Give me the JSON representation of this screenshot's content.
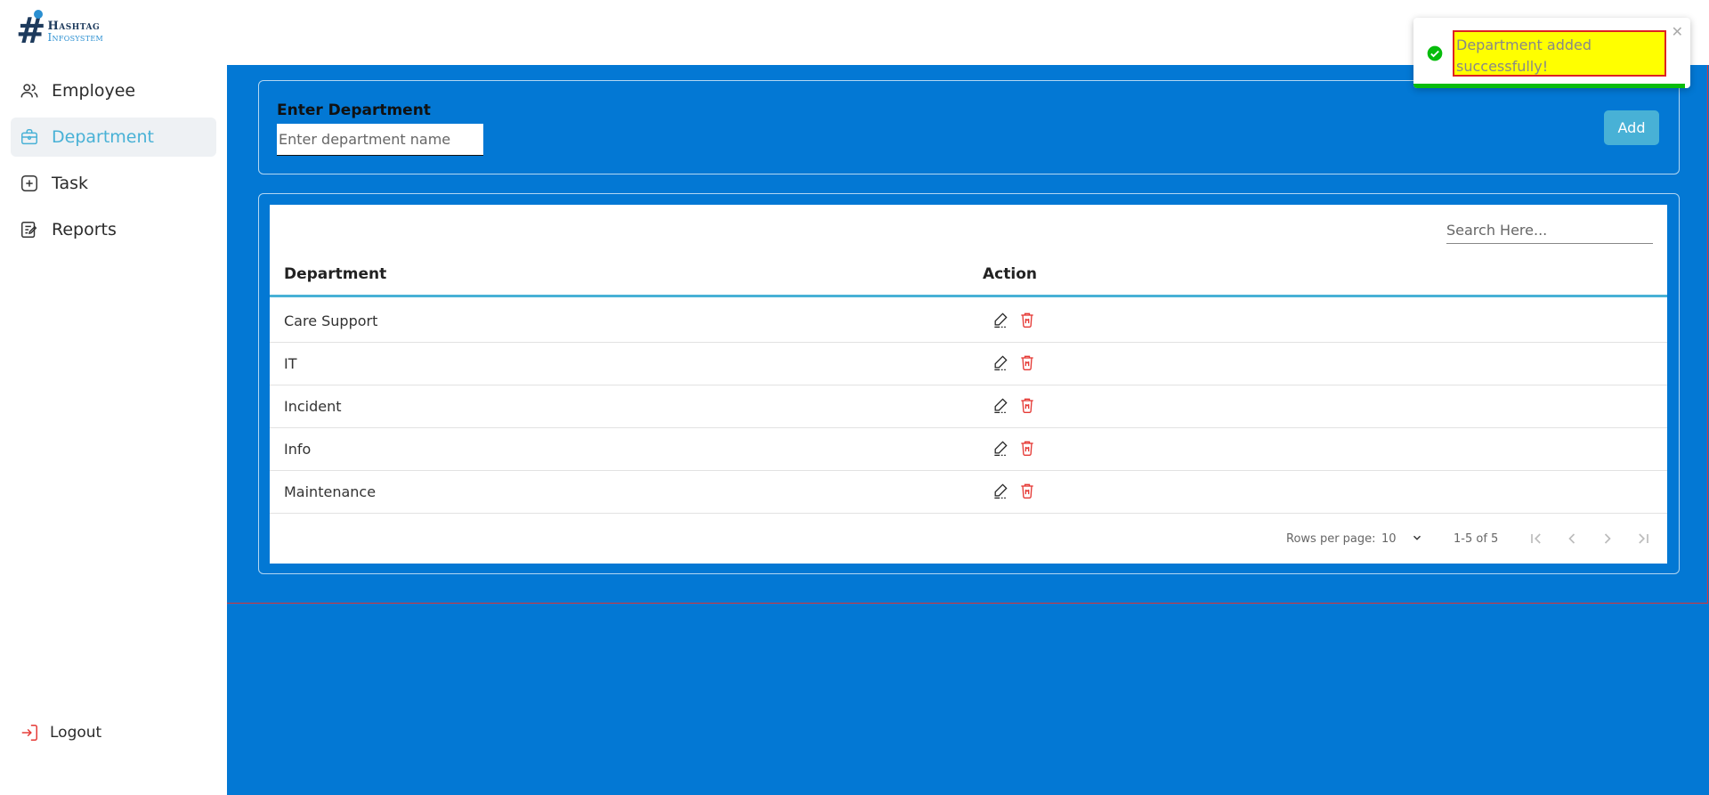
{
  "brand": {
    "line1": "Hashtag",
    "line2": "Infosystem"
  },
  "sidebar": {
    "items": [
      {
        "label": "Employee",
        "icon": "users-icon"
      },
      {
        "label": "Department",
        "icon": "briefcase-icon",
        "active": true
      },
      {
        "label": "Task",
        "icon": "plus-square-icon"
      },
      {
        "label": "Reports",
        "icon": "report-edit-icon"
      }
    ],
    "logout_label": "Logout"
  },
  "entry": {
    "label": "Enter Department",
    "placeholder": "Enter department name",
    "value": "",
    "add_label": "Add"
  },
  "table": {
    "search_placeholder": "Search Here...",
    "columns": [
      "Department",
      "Action"
    ],
    "rows": [
      "Care Support",
      "IT",
      "Incident",
      "Info",
      "Maintenance"
    ]
  },
  "pagination": {
    "rows_per_page_label": "Rows per page:",
    "rows_per_page": "10",
    "range": "1-5 of 5"
  },
  "toast": {
    "message": "Department added successfully!",
    "type": "success"
  },
  "colors": {
    "main_bg": "#0378d4",
    "accent": "#48b1d6",
    "delete": "#e53935",
    "success": "#07bc0c"
  }
}
